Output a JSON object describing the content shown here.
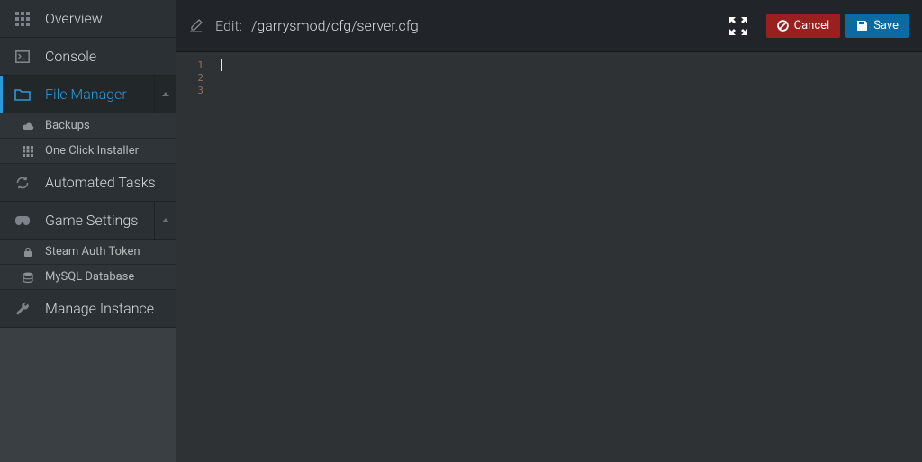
{
  "sidebar": {
    "items": [
      {
        "label": "Overview"
      },
      {
        "label": "Console"
      },
      {
        "label": "File Manager",
        "children": [
          {
            "label": "Backups"
          },
          {
            "label": "One Click Installer"
          }
        ]
      },
      {
        "label": "Automated Tasks"
      },
      {
        "label": "Game Settings",
        "children": [
          {
            "label": "Steam Auth Token"
          },
          {
            "label": "MySQL Database"
          }
        ]
      },
      {
        "label": "Manage Instance"
      }
    ]
  },
  "toolbar": {
    "edit_label": "Edit:",
    "file_path": "/garrysmod/cfg/server.cfg",
    "cancel_label": "Cancel",
    "save_label": "Save"
  },
  "editor": {
    "line_numbers": [
      "1",
      "2",
      "3"
    ],
    "content": ""
  }
}
